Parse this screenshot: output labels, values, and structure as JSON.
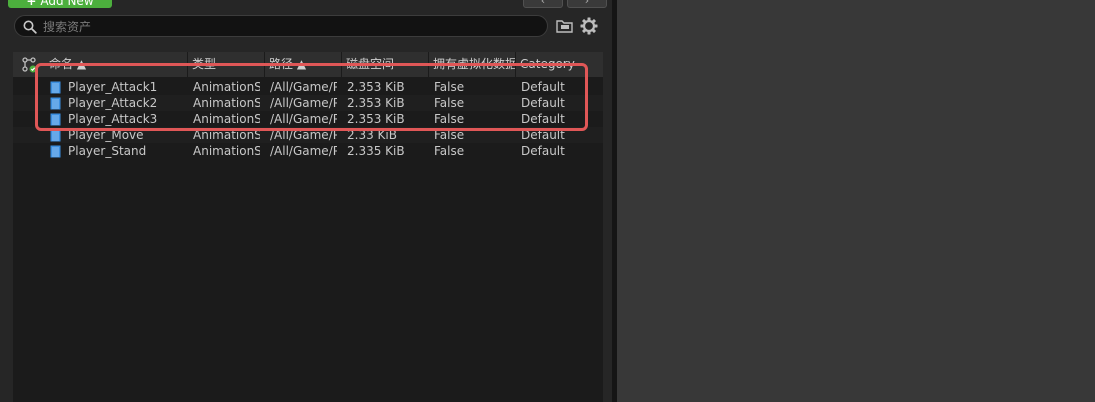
{
  "toolbar": {
    "add_new_label": "Add New",
    "back_label": "‹",
    "forward_label": "›"
  },
  "search": {
    "placeholder": "搜索资产",
    "value": ""
  },
  "table": {
    "columns": [
      {
        "label": "命名 ▲"
      },
      {
        "label": "类型"
      },
      {
        "label": "路径 ▲"
      },
      {
        "label": "磁盘空间"
      },
      {
        "label": "拥有虚拟化数据"
      },
      {
        "label": "Category"
      }
    ],
    "rows": [
      {
        "name": "Player_Attack1",
        "type": "AnimationSequence",
        "path": "/All/Game/Player",
        "size": "2.353 KiB",
        "virtualized": "False",
        "category": "Default"
      },
      {
        "name": "Player_Attack2",
        "type": "AnimationSequence",
        "path": "/All/Game/Player",
        "size": "2.353 KiB",
        "virtualized": "False",
        "category": "Default"
      },
      {
        "name": "Player_Attack3",
        "type": "AnimationSequence",
        "path": "/All/Game/Player",
        "size": "2.353 KiB",
        "virtualized": "False",
        "category": "Default"
      },
      {
        "name": "Player_Move",
        "type": "AnimationSequence",
        "path": "/All/Game/Player",
        "size": "2.33 KiB",
        "virtualized": "False",
        "category": "Default"
      },
      {
        "name": "Player_Stand",
        "type": "AnimationSequence",
        "path": "/All/Game/Player",
        "size": "2.335 KiB",
        "virtualized": "False",
        "category": "Default"
      }
    ]
  },
  "icons": {
    "search": "search-icon",
    "folder": "folder-icon",
    "settings": "gear-icon",
    "view_options": "view-options-icon",
    "asset": "animation-asset-icon"
  },
  "colors": {
    "add_new": "#4caf3d",
    "highlight": "#e05757",
    "asset_icon": "#3b8fe0"
  }
}
